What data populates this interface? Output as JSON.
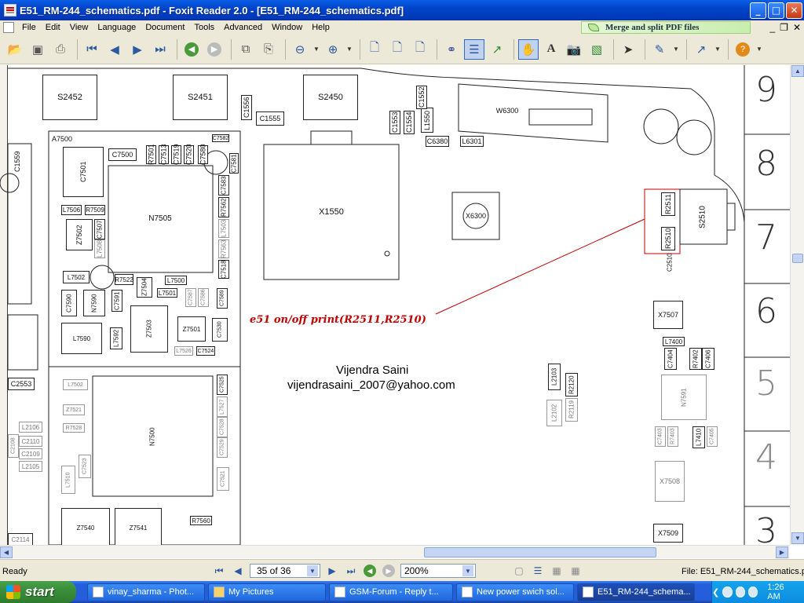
{
  "window": {
    "title": "E51_RM-244_schematics.pdf - Foxit Reader 2.0 - [E51_RM-244_schematics.pdf]",
    "min": "_",
    "max": "□",
    "close": "✕"
  },
  "menu": {
    "items": [
      "File",
      "Edit",
      "View",
      "Language",
      "Document",
      "Tools",
      "Advanced",
      "Window",
      "Help"
    ],
    "banner": "Merge and split PDF files"
  },
  "toolbar": {
    "icons": [
      "open-icon",
      "save-icon",
      "print-icon",
      "first-page-icon",
      "previous-page-icon",
      "next-page-icon",
      "last-page-icon",
      "back-icon",
      "forward-icon",
      "copy-icon",
      "paste-icon",
      "zoom-out-icon",
      "zoom-in-icon",
      "actual-size-icon",
      "fit-page-icon",
      "fit-width-icon",
      "binoculars-icon",
      "bookmark-icon",
      "export-icon",
      "hand-tool-icon",
      "text-select-icon",
      "snapshot-icon",
      "image-tool-icon",
      "pointer-icon",
      "annotation-icon",
      "arrow-tool-icon",
      "help-icon"
    ]
  },
  "schematic": {
    "components": [
      "S2452",
      "S2451",
      "S2450",
      "C1556",
      "C1555",
      "C1553",
      "C1554",
      "L1550",
      "C1552",
      "W6300",
      "C6380",
      "L6301",
      "A7500",
      "C7500",
      "R7501",
      "C7513",
      "C7519",
      "C7520",
      "C7580",
      "C7582",
      "C7581",
      "C1559",
      "C7501",
      "N7505",
      "L7506",
      "R7509",
      "Z7502",
      "C7507",
      "L7508",
      "C7583",
      "R7562",
      "L7503",
      "R7563",
      "C7518",
      "X1550",
      "X6300",
      "R2511",
      "R2510",
      "C2510",
      "S2510",
      "L7502",
      "R7522",
      "L7500",
      "Z7504",
      "L7501",
      "C7587",
      "C7586",
      "C7589",
      "C7590",
      "N7590",
      "C7591",
      "Z7503",
      "Z7501",
      "L7590",
      "L7592",
      "L7526",
      "C7524",
      "C7530",
      "X7507",
      "L7400",
      "C7404",
      "R7402",
      "C7406",
      "L2103",
      "R2120",
      "L2102",
      "R2119",
      "N7591",
      "C7403",
      "R7403",
      "L7410",
      "C7405",
      "X7508",
      "X7509",
      "C2553",
      "L7502",
      "Z7521",
      "R7528",
      "N7500",
      "C7525",
      "L7527",
      "C7528",
      "C7529",
      "C7521",
      "L2106",
      "C2108",
      "C2110",
      "C2109",
      "L2105",
      "L7510",
      "C7523",
      "Z7540",
      "Z7541",
      "R7560",
      "C2114"
    ],
    "annotation": "e51 on/off print(R2511,R2510)",
    "author": "Vijendra Saini",
    "email": "vijendrasaini_2007@yahoo.com",
    "grid_rows": [
      "9",
      "8",
      "7",
      "6",
      "5",
      "4",
      "3"
    ]
  },
  "status": {
    "ready": "Ready",
    "page": "35 of 36",
    "zoom": "200%",
    "file": "File: E51_RM-244_schematics.pdf"
  },
  "taskbar": {
    "start": "start",
    "tasks": [
      "vinay_sharma - Phot...",
      "My Pictures",
      "GSM-Forum - Reply t...",
      "New power swich sol...",
      "E51_RM-244_schema..."
    ],
    "time": "1:26 AM"
  }
}
